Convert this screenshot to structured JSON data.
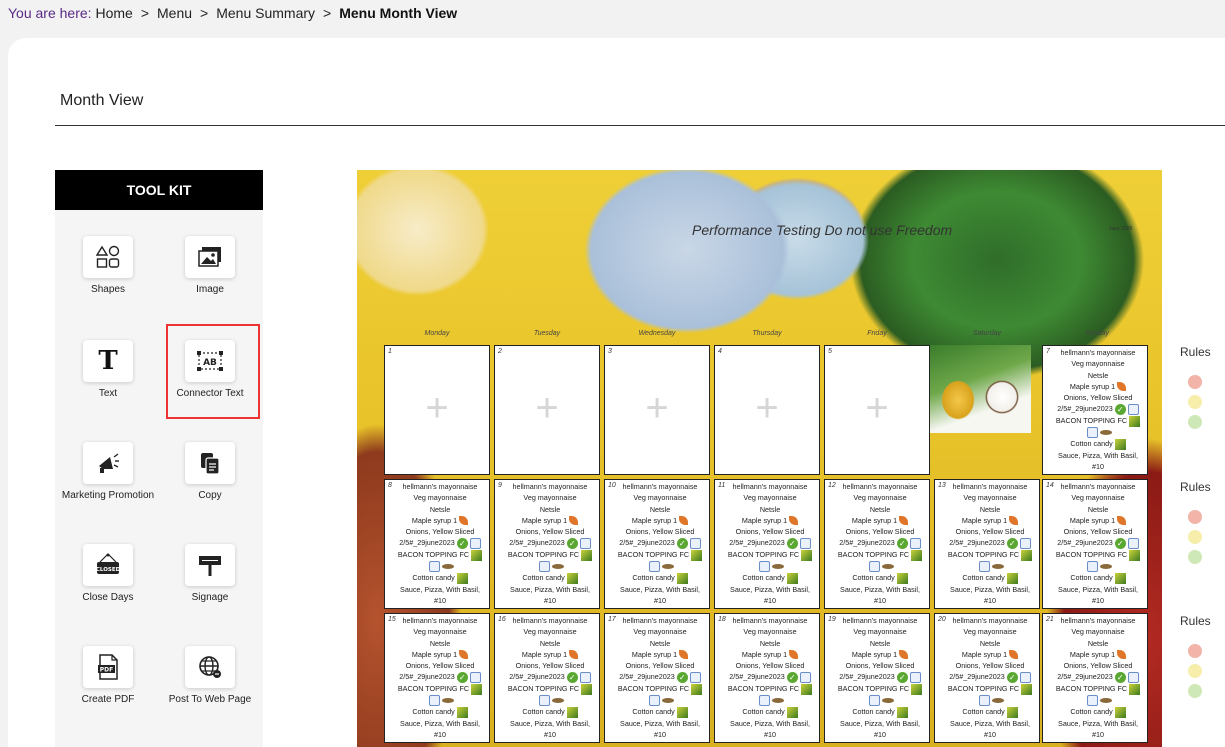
{
  "breadcrumb": {
    "lead": "You are here:",
    "items": [
      "Home",
      "Menu",
      "Menu Summary"
    ],
    "current": "Menu Month View",
    "separator": ">"
  },
  "page": {
    "title": "Month View"
  },
  "toolkit": {
    "header": "TOOL KIT",
    "tools": [
      {
        "label": "Shapes",
        "icon": "shapes-icon"
      },
      {
        "label": "Image",
        "icon": "image-icon"
      },
      {
        "label": "Text",
        "icon": "text-icon"
      },
      {
        "label": "Connector Text",
        "icon": "connector-text-icon"
      },
      {
        "label": "Marketing Promotion",
        "icon": "megaphone-icon"
      },
      {
        "label": "Copy",
        "icon": "copy-icon"
      },
      {
        "label": "Close Days",
        "icon": "closed-sign-icon"
      },
      {
        "label": "Signage",
        "icon": "signpost-icon"
      },
      {
        "label": "Create PDF",
        "icon": "pdf-icon"
      },
      {
        "label": "Post To Web Page",
        "icon": "globe-icon"
      }
    ],
    "highlight_color": "#e33333"
  },
  "calendar": {
    "title": "Performance Testing Do not use Freedom",
    "date_label": "June 2026",
    "day_names": [
      "Monday",
      "Tuesday",
      "Wednesday",
      "Thursday",
      "Friday",
      "Saturday",
      "Sunday"
    ],
    "plus": "+",
    "menu_items": [
      "hellmann's mayonnaise",
      "Veg mayonnaise",
      "Netsle",
      "Maple syrup 1",
      "Onions, Yellow Sliced",
      "2/5#_29june2023",
      "BACON TOPPING FC",
      "",
      "Cotton candy",
      "Sauce, Pizza, With Basil,",
      "#10"
    ],
    "week1": [
      {
        "num": "1",
        "type": "empty"
      },
      {
        "num": "2",
        "type": "empty"
      },
      {
        "num": "3",
        "type": "empty"
      },
      {
        "num": "4",
        "type": "empty"
      },
      {
        "num": "5",
        "type": "empty"
      },
      {
        "num": "",
        "type": "photo"
      },
      {
        "num": "7",
        "type": "menu"
      }
    ],
    "week2": [
      "8",
      "9",
      "10",
      "11",
      "12",
      "13",
      "14"
    ],
    "week3": [
      "15",
      "16",
      "17",
      "18",
      "19",
      "20",
      "21"
    ]
  },
  "rules": {
    "label": "Rules"
  }
}
